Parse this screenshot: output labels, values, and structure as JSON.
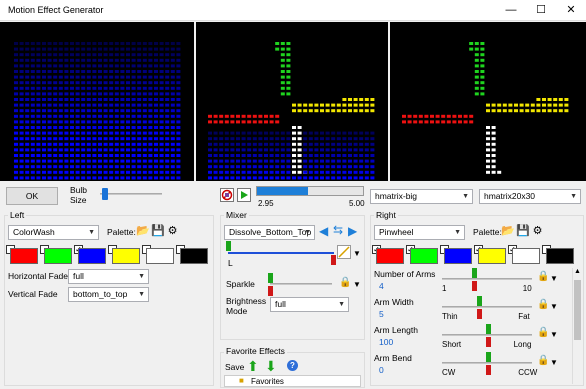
{
  "window": {
    "title": "Motion Effect Generator",
    "minimize": "—",
    "maximize": "☐",
    "close": "✕"
  },
  "toolbar": {
    "ok_label": "OK",
    "bulb_size_label": "Bulb\nSize",
    "bulb_size_value": 0.04,
    "progress_fraction": 0.48,
    "time_start": "2.95",
    "time_end": "5.00",
    "model_select": "hmatrix-big",
    "size_select": "hmatrix20x30"
  },
  "left": {
    "group_label": "Left",
    "effect": "ColorWash",
    "palette_label": "Palette:",
    "colors": [
      "#ff0000",
      "#00ff00",
      "#0000ff",
      "#ffff00",
      "#ffffff",
      "#000000"
    ],
    "checked": [
      false,
      false,
      true,
      false,
      false,
      false
    ],
    "horizontal_fade_label": "Horizontal Fade",
    "horizontal_fade": "full",
    "vertical_fade_label": "Vertical Fade",
    "vertical_fade": "bottom_to_top"
  },
  "mixer": {
    "group_label": "Mixer",
    "transition": "Dissolve_Bottom_Top",
    "left_label": "L",
    "mix_value": 1.0,
    "sparkle_label": "Sparkle",
    "sparkle_value": 0.0,
    "brightness_mode_label": "Brightness\nMode",
    "brightness_mode": "full"
  },
  "favorites": {
    "group_label": "Favorite Effects",
    "save_label": "Save",
    "tree_root": "Favorites"
  },
  "right": {
    "group_label": "Right",
    "effect": "Pinwheel",
    "palette_label": "Palette:",
    "colors": [
      "#ff0000",
      "#00ff00",
      "#0000ff",
      "#ffff00",
      "#ffffff",
      "#000000"
    ],
    "checked": [
      true,
      true,
      false,
      true,
      true,
      false
    ],
    "params": [
      {
        "label": "Number of Arms",
        "value": "4",
        "min_label": "1",
        "max_label": "10",
        "fraction": 0.34
      },
      {
        "label": "Arm Width",
        "value": "5",
        "min_label": "Thin",
        "max_label": "Fat",
        "fraction": 0.4
      },
      {
        "label": "Arm Length",
        "value": "100",
        "min_label": "Short",
        "max_label": "Long",
        "fraction": 0.5
      },
      {
        "label": "Arm Bend",
        "value": "0",
        "min_label": "CW",
        "max_label": "CCW",
        "fraction": 0.5
      }
    ]
  },
  "icons": {
    "palette_open": "folder-open-icon",
    "palette_save": "save-icon",
    "palette_settings": "gear-icon",
    "lock": "lock-icon",
    "play": "play-icon",
    "stop": "stop-icon",
    "arrow_left": "arrow-left-icon",
    "arrow_swap": "swap-icon",
    "arrow_right": "arrow-right-icon",
    "arrow_up_green": "arrow-up-icon",
    "arrow_down_green": "arrow-down-icon",
    "help": "help-icon"
  }
}
